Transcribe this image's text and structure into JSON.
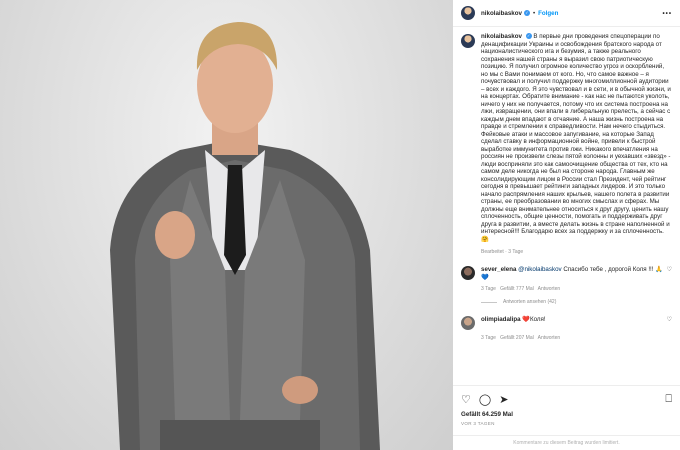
{
  "post": {
    "username": "nikolaibaskov",
    "follow_label": "Folgen",
    "more_label": "•••",
    "caption": "В первые дни проведения спецоперации по денацификации Украины и освобождения братского народа от националистического ига и безумия, а также реального сохранения нашей страны я выразил свою патриотическую позицию. Я получил огромное количество угроз и оскорблений, но мы с Вами понимаем от кого. Но, что самое важное – я почувствовал и получил поддержку многомиллионной аудитории – всех и каждого. Я это чувствовал и в сети, и в обычной жизни, и на концертах. Обратите внимание - как нас не пытаются уколоть, ничего у них не получается, потому что их система построена на лжи, извращении, они впали в либеральную прелесть, а сейчас с каждым днем впадают в отчаяние. А наша жизнь построена на правде и стремлении к справедливости. Нам нечего стыдиться. Фейковые атаки и массовое запугивание, на которые Запад сделал ставку в информационной войне, привели к быстрой выработке иммунитета против лжи. Никакого впечатления на россиян не произвели слезы пятой колонны и уехавших «звезд» - люди восприняли это как самоочищение общества от тех, кто на самом деле никогда не был на стороне народа. Главным же консолидирующим лицом в России стал Президент, чей рейтинг сегодня в превышает рейтинги западных лидеров. И это только начало распрямления наших крыльев, нашего полета в развитии страны, ее преобразовании во многих смыслах и сферах. Мы должны еще внимательнее относиться к друг другу, ценить нашу сплоченность, общие ценности, помогать и поддерживать друг друга в развитии, а вместе делать жизнь в стране наполненной и интересной!!! Благодарю всех за поддержку и за сплоченность. 🤗",
    "caption_meta": "Bearbeitet · 3 Tage",
    "likes": "Gefällt 64.259 Mal",
    "date": "VOR 3 TAGEN",
    "add_comment_placeholder": "Kommentare zu diesem Beitrag wurden limitiert."
  },
  "comments": [
    {
      "user": "sever_elena",
      "mention": "@nikolaibaskov",
      "text": "Спасибо тебе , дорогой Коля !!! 🙏💙",
      "age": "3 Tage",
      "likes": "Gefällt 777 Mal",
      "reply_label": "Antworten",
      "view_replies": "Antworten ansehen (42)"
    },
    {
      "user": "olimpiadalipa",
      "text": "❤️Коля!",
      "age": "3 Tage",
      "likes": "Gefällt 207 Mal",
      "reply_label": "Antworten"
    }
  ],
  "icons": {
    "like": "heart-icon",
    "comment": "comment-icon",
    "share": "share-icon",
    "save": "bookmark-icon"
  }
}
